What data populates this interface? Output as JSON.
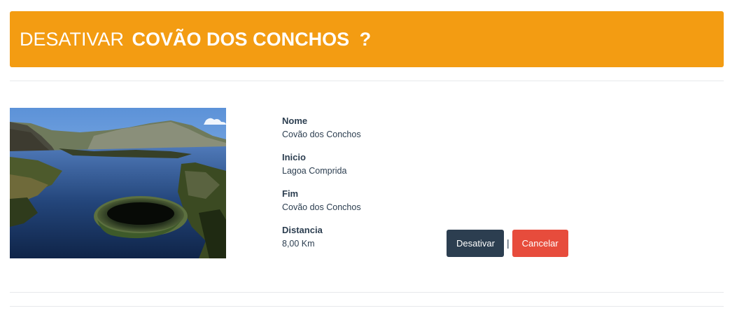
{
  "header": {
    "prefix": "DESATIVAR",
    "name": "COVÃO DOS CONCHOS",
    "suffix": "?",
    "background": "#f39c12"
  },
  "fields": [
    {
      "label": "Nome",
      "value": "Covão dos Conchos"
    },
    {
      "label": "Inicio",
      "value": "Lagoa Comprida"
    },
    {
      "label": "Fim",
      "value": "Covão dos Conchos"
    },
    {
      "label": "Distancia",
      "value": "8,00 Km"
    }
  ],
  "actions": {
    "deactivate_label": "Desativar",
    "separator": "|",
    "cancel_label": "Cancelar",
    "deactivate_color": "#2c3e50",
    "cancel_color": "#e74c3c"
  },
  "image": {
    "subject": "lake-with-circular-spillway-photo"
  }
}
